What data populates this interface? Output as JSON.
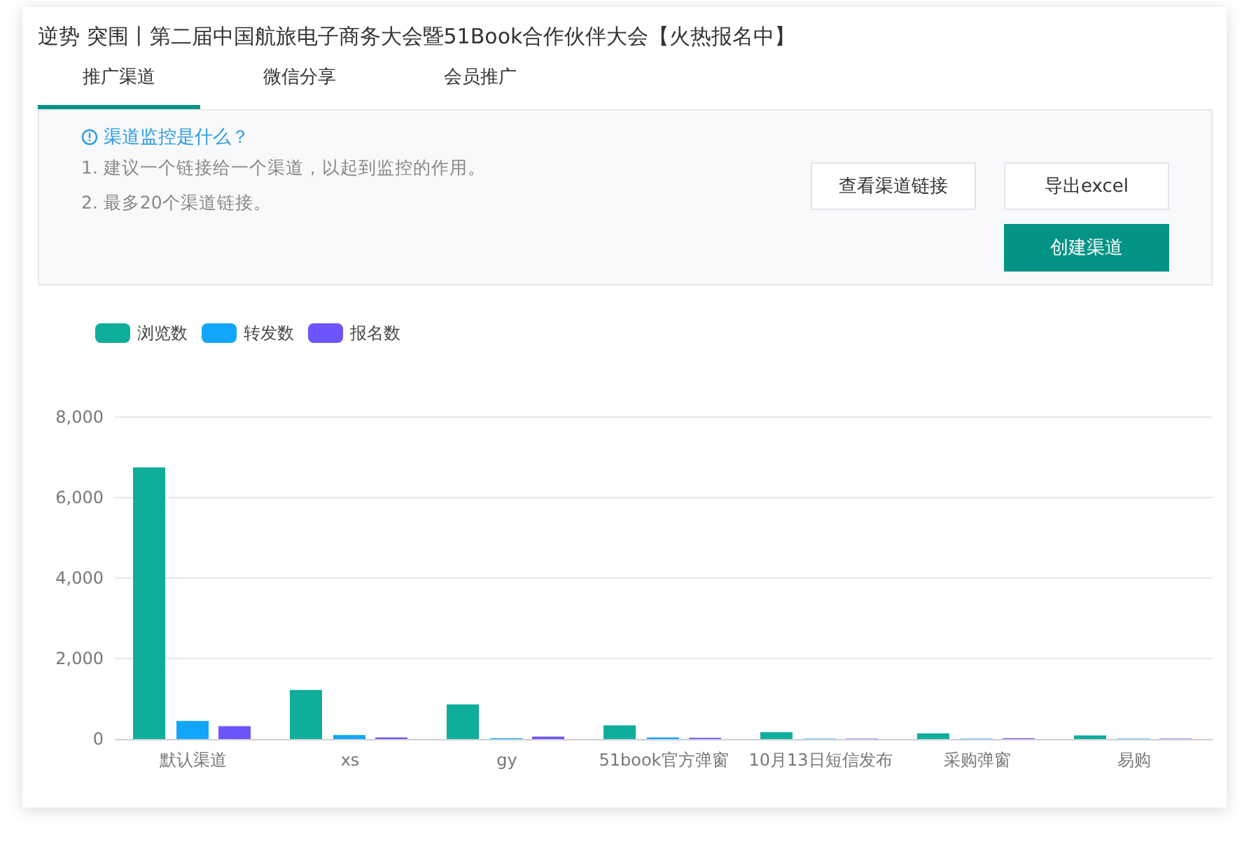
{
  "title": "逆势 突围丨第二届中国航旅电子商务大会暨51Book合作伙伴大会【火热报名中】",
  "tabs": [
    {
      "label": "推广渠道",
      "selected": true
    },
    {
      "label": "微信分享",
      "selected": false
    },
    {
      "label": "会员推广",
      "selected": false
    }
  ],
  "info": {
    "heading": "渠道监控是什么？",
    "lines": [
      "1. 建议一个链接给一个渠道，以起到监控的作用。",
      "2. 最多20个渠道链接。"
    ]
  },
  "buttons": [
    {
      "label": "查看渠道链接",
      "kind": "plain"
    },
    {
      "label": "导出excel",
      "kind": "plain"
    },
    {
      "label": "创建渠道",
      "kind": "primary"
    }
  ],
  "chart_data": {
    "type": "bar",
    "categories": [
      "默认渠道",
      "xs",
      "gy",
      "51book官方弹窗",
      "10月13日短信发布",
      "采购弹窗",
      "易购"
    ],
    "series": [
      {
        "name": "浏览数",
        "color": "#0fae9c",
        "values": [
          6750,
          1220,
          860,
          340,
          170,
          140,
          90
        ]
      },
      {
        "name": "转发数",
        "color": "#11a6f9",
        "values": [
          450,
          100,
          20,
          40,
          10,
          10,
          10
        ]
      },
      {
        "name": "报名数",
        "color": "#6c55fb",
        "values": [
          320,
          40,
          60,
          30,
          10,
          20,
          10
        ]
      }
    ],
    "grid": true,
    "ylim": [
      0,
      8000
    ],
    "yticks": [
      {
        "value": 0,
        "label": "0"
      },
      {
        "value": 2000,
        "label": "2,000"
      },
      {
        "value": 4000,
        "label": "4,000"
      },
      {
        "value": 6000,
        "label": "6,000"
      },
      {
        "value": 8000,
        "label": "8,000"
      }
    ]
  }
}
